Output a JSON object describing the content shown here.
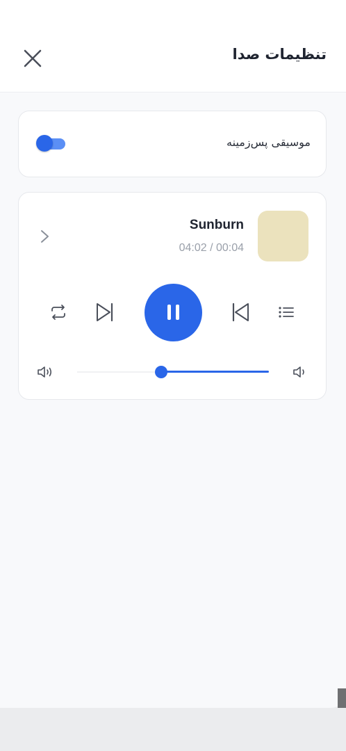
{
  "header": {
    "title": "تنظیمات صدا"
  },
  "background_music": {
    "label": "موسیقی پس‌زمینه",
    "enabled": true
  },
  "player": {
    "track_title": "Sunburn",
    "time_display": "04:02 / 00:04",
    "is_playing": true,
    "volume_level": 0.56
  },
  "colors": {
    "accent": "#2a66e8",
    "cover": "#ebe2bd",
    "muted_text": "#9aa0aa"
  }
}
